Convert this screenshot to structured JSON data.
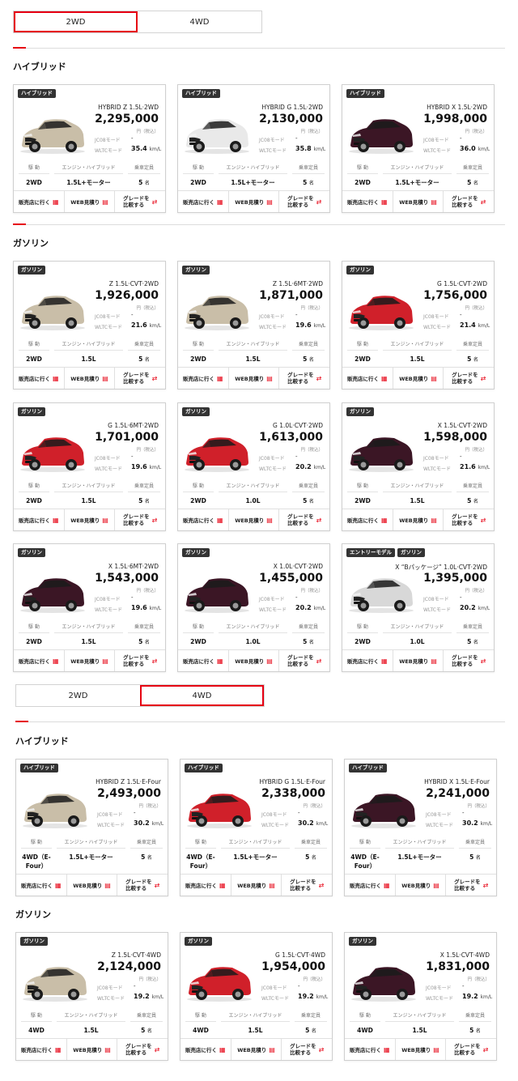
{
  "tabs": [
    "2WD",
    "4WD"
  ],
  "labels": {
    "drive": "駆 動",
    "engine": "エンジン・ハイブリッド",
    "seats": "乗車定員",
    "seat_unit": "名",
    "tax": "円（税込）",
    "jc08": "JC08モード",
    "wltc": "WLTCモード",
    "kmL": "km/L",
    "dealer": "販売店に行く",
    "web": "WEB見積り",
    "compare1": "グレードを",
    "compare2": "比較する"
  },
  "sections": {
    "s1": "ハイブリッド",
    "s2": "ガソリン",
    "s3": "ハイブリッド",
    "s4": "ガソリン"
  },
  "cars": [
    {
      "badges": [
        "ハイブリッド"
      ],
      "grade": "HYBRID Z 1.5L·2WD",
      "price": "2,295,000",
      "jc08": "-",
      "wltc": "35.4",
      "drive": "2WD",
      "engine": "1.5L+モーター",
      "seats": "5",
      "color": "#c9bea8"
    },
    {
      "badges": [
        "ハイブリッド"
      ],
      "grade": "HYBRID G 1.5L·2WD",
      "price": "2,130,000",
      "jc08": "-",
      "wltc": "35.8",
      "drive": "2WD",
      "engine": "1.5L+モーター",
      "seats": "5",
      "color": "#e9e9e9"
    },
    {
      "badges": [
        "ハイブリッド"
      ],
      "grade": "HYBRID X 1.5L·2WD",
      "price": "1,998,000",
      "jc08": "-",
      "wltc": "36.0",
      "drive": "2WD",
      "engine": "1.5L+モーター",
      "seats": "5",
      "color": "#3b1625"
    },
    {
      "badges": [
        "ガソリン"
      ],
      "grade": "Z 1.5L·CVT·2WD",
      "price": "1,926,000",
      "jc08": "-",
      "wltc": "21.6",
      "drive": "2WD",
      "engine": "1.5L",
      "seats": "5",
      "color": "#c9bea8"
    },
    {
      "badges": [
        "ガソリン"
      ],
      "grade": "Z 1.5L·6MT·2WD",
      "price": "1,871,000",
      "jc08": "-",
      "wltc": "19.6",
      "drive": "2WD",
      "engine": "1.5L",
      "seats": "5",
      "color": "#c9bea8"
    },
    {
      "badges": [
        "ガソリン"
      ],
      "grade": "G 1.5L·CVT·2WD",
      "price": "1,756,000",
      "jc08": "-",
      "wltc": "21.4",
      "drive": "2WD",
      "engine": "1.5L",
      "seats": "5",
      "color": "#d0202a"
    },
    {
      "badges": [
        "ガソリン"
      ],
      "grade": "G 1.5L·6MT·2WD",
      "price": "1,701,000",
      "jc08": "-",
      "wltc": "19.6",
      "drive": "2WD",
      "engine": "1.5L",
      "seats": "5",
      "color": "#d0202a"
    },
    {
      "badges": [
        "ガソリン"
      ],
      "grade": "G 1.0L·CVT·2WD",
      "price": "1,613,000",
      "jc08": "-",
      "wltc": "20.2",
      "drive": "2WD",
      "engine": "1.0L",
      "seats": "5",
      "color": "#d0202a"
    },
    {
      "badges": [
        "ガソリン"
      ],
      "grade": "X 1.5L·CVT·2WD",
      "price": "1,598,000",
      "jc08": "-",
      "wltc": "21.6",
      "drive": "2WD",
      "engine": "1.5L",
      "seats": "5",
      "color": "#3b1625"
    },
    {
      "badges": [
        "ガソリン"
      ],
      "grade": "X 1.5L·6MT·2WD",
      "price": "1,543,000",
      "jc08": "-",
      "wltc": "19.6",
      "drive": "2WD",
      "engine": "1.5L",
      "seats": "5",
      "color": "#3b1625"
    },
    {
      "badges": [
        "ガソリン"
      ],
      "grade": "X 1.0L·CVT·2WD",
      "price": "1,455,000",
      "jc08": "-",
      "wltc": "20.2",
      "drive": "2WD",
      "engine": "1.0L",
      "seats": "5",
      "color": "#3b1625"
    },
    {
      "badges": [
        "エントリーモデル",
        "ガソリン"
      ],
      "grade": "X “Bパッケージ” 1.0L·CVT·2WD",
      "price": "1,395,000",
      "jc08": "-",
      "wltc": "20.2",
      "drive": "2WD",
      "engine": "1.0L",
      "seats": "5",
      "color": "#d8d8d8"
    },
    {
      "badges": [
        "ハイブリッド"
      ],
      "grade": "HYBRID Z 1.5L·E-Four",
      "price": "2,493,000",
      "jc08": "-",
      "wltc": "30.2",
      "drive": "4WD（E-Four）",
      "engine": "1.5L+モーター",
      "seats": "5",
      "color": "#c9bea8"
    },
    {
      "badges": [
        "ハイブリッド"
      ],
      "grade": "HYBRID G 1.5L·E-Four",
      "price": "2,338,000",
      "jc08": "-",
      "wltc": "30.2",
      "drive": "4WD（E-Four）",
      "engine": "1.5L+モーター",
      "seats": "5",
      "color": "#d0202a"
    },
    {
      "badges": [
        "ハイブリッド"
      ],
      "grade": "HYBRID X 1.5L·E-Four",
      "price": "2,241,000",
      "jc08": "-",
      "wltc": "30.2",
      "drive": "4WD（E-Four）",
      "engine": "1.5L+モーター",
      "seats": "5",
      "color": "#3b1625"
    },
    {
      "badges": [
        "ガソリン"
      ],
      "grade": "Z 1.5L·CVT·4WD",
      "price": "2,124,000",
      "jc08": "-",
      "wltc": "19.2",
      "drive": "4WD",
      "engine": "1.5L",
      "seats": "5",
      "color": "#c9bea8"
    },
    {
      "badges": [
        "ガソリン"
      ],
      "grade": "G 1.5L·CVT·4WD",
      "price": "1,954,000",
      "jc08": "-",
      "wltc": "19.2",
      "drive": "4WD",
      "engine": "1.5L",
      "seats": "5",
      "color": "#d0202a"
    },
    {
      "badges": [
        "ガソリン"
      ],
      "grade": "X 1.5L·CVT·4WD",
      "price": "1,831,000",
      "jc08": "-",
      "wltc": "19.2",
      "drive": "4WD",
      "engine": "1.5L",
      "seats": "5",
      "color": "#3b1625"
    }
  ],
  "colors": {
    "accent": "#e60012",
    "badge": "#333333"
  }
}
